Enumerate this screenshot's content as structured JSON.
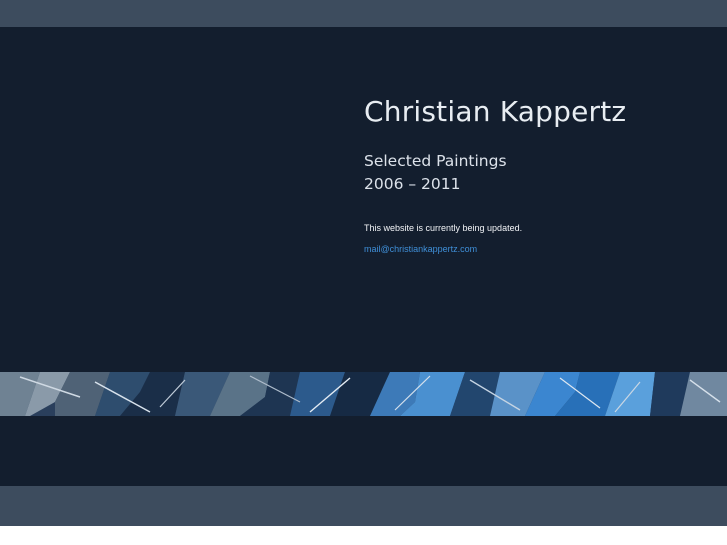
{
  "header": {
    "title": "Christian Kappertz",
    "subtitle_line1": "Selected Paintings",
    "subtitle_line2": "2006 – 2011"
  },
  "notice": {
    "text": "This website is currently being updated."
  },
  "contact": {
    "email": "mail@christiankappertz.com"
  },
  "colors": {
    "bar": "#3d4c5e",
    "background": "#131e2e",
    "text": "#e8edf2",
    "link": "#3f8fd8"
  }
}
